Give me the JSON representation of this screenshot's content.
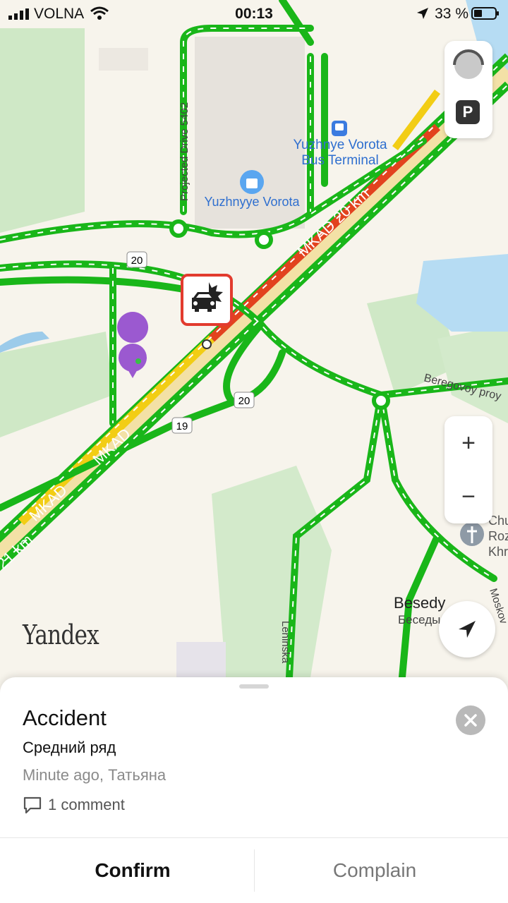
{
  "status_bar": {
    "carrier": "VOLNA",
    "time": "00:13",
    "battery": "33 %"
  },
  "map": {
    "labels": {
      "bus_terminal_line1": "Yuzhnye Vorota",
      "bus_terminal_line2": "Bus Terminal",
      "mall": "Yuzhnyye Vorota",
      "projected_drive": "Projected Drive 5402",
      "mkad_20km": "MKAD 20 km",
      "mkad_a": "MKAD",
      "mkad_b": "MKAD",
      "km21": "21 km",
      "route20_a": "20",
      "route20_b": "20",
      "route19": "19",
      "beregovoy": "Beregovoy proy",
      "besedy_en": "Besedy",
      "besedy_ru": "Беседы",
      "church_1": "Chu",
      "church_2": "Roz",
      "church_3": "Khr",
      "leninska": "Leninska",
      "moskov": "Moskov"
    },
    "logo": "Yandex",
    "parking_label": "P",
    "zoom_in": "+",
    "zoom_out": "−",
    "colors": {
      "traffic_free": "#19b619",
      "traffic_slow": "#f2cd14",
      "traffic_jam": "#e2421e",
      "accent_incident": "#e23b2e"
    }
  },
  "incident": {
    "title": "Accident",
    "subtitle": "Средний ряд",
    "meta": "Minute ago, Татьяна",
    "comments": "1 comment",
    "confirm": "Confirm",
    "complain": "Complain"
  }
}
